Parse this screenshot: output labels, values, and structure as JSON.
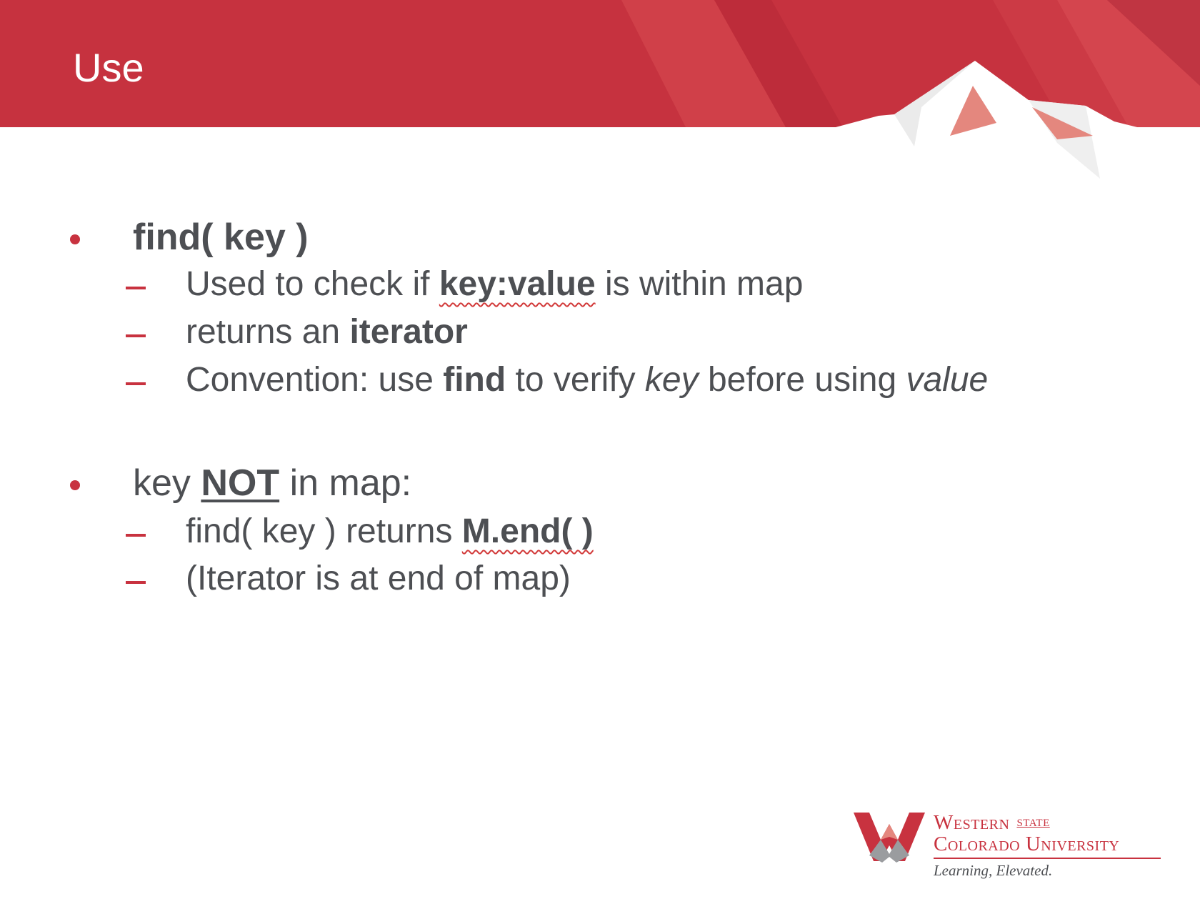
{
  "slide": {
    "title": "Use"
  },
  "bullets": [
    {
      "parts": [
        {
          "text": "find( key )",
          "bold": true
        }
      ],
      "sub": [
        {
          "parts": [
            {
              "text": "Used to check if "
            },
            {
              "text": "key:value",
              "bold": true,
              "squiggle": true
            },
            {
              "text": " is within map"
            }
          ]
        },
        {
          "parts": [
            {
              "text": "returns an "
            },
            {
              "text": "iterator",
              "bold": true
            }
          ]
        },
        {
          "parts": [
            {
              "text": "Convention: use "
            },
            {
              "text": "find",
              "bold": true
            },
            {
              "text": " to verify "
            },
            {
              "text": "key",
              "italic": true
            },
            {
              "text": " before using "
            },
            {
              "text": "value",
              "italic": true
            }
          ]
        }
      ]
    },
    {
      "parts": [
        {
          "text": "key "
        },
        {
          "text": "NOT",
          "bold": true,
          "underline": true
        },
        {
          "text": " in map:"
        }
      ],
      "sub": [
        {
          "parts": [
            {
              "text": "find( key ) returns "
            },
            {
              "text": "M.end( )",
              "bold": true,
              "squiggle": true
            }
          ]
        },
        {
          "parts": [
            {
              "text": "(Iterator is at end of map)"
            }
          ]
        }
      ]
    }
  ],
  "logo": {
    "line1": "Western",
    "line1_small": "STATE",
    "line2": "Colorado University",
    "tagline": "Learning, Elevated."
  },
  "colors": {
    "header_red": "#c8323f",
    "accent_red": "#c8323f",
    "text_gray": "#4d4f53"
  }
}
